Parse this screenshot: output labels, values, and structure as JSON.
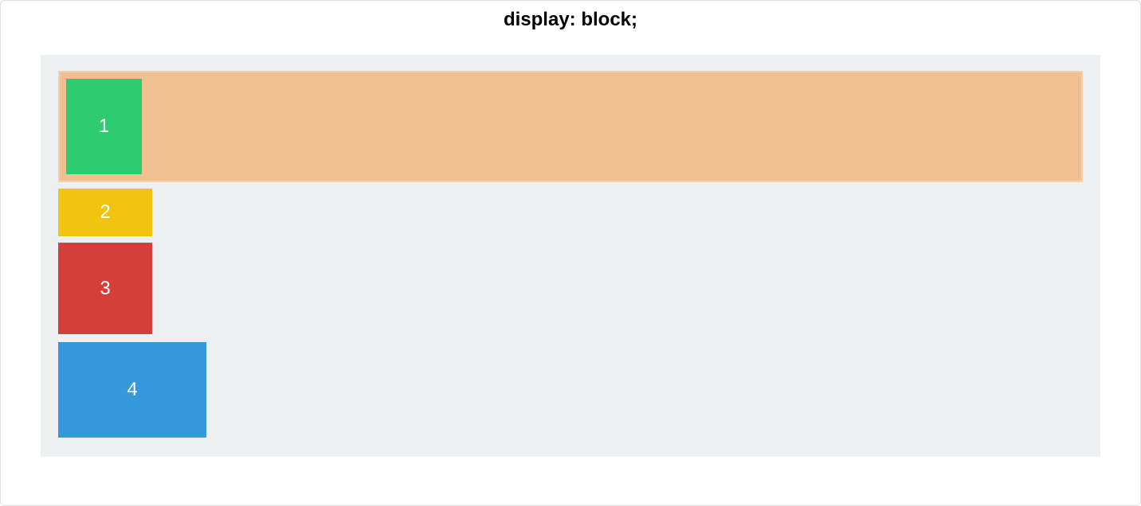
{
  "title": "display: block;",
  "boxes": {
    "box1": "1",
    "box2": "2",
    "box3": "3",
    "box4": "4"
  },
  "colors": {
    "containerBg": "#ecf0f1",
    "wrapperBg": "#f0c090",
    "wrapperBorder": "#f5d0a8",
    "box1": "#2ecc71",
    "box2": "#f1c40f",
    "box3": "#d43f3a",
    "box4": "#3498db"
  }
}
